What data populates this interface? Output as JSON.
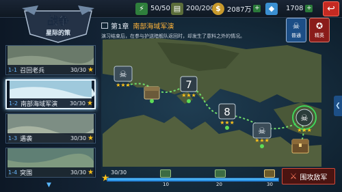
{
  "top_bar": {
    "energy": "50/50",
    "supply": "200/200",
    "gold": "2087万",
    "diamond": "1708",
    "back_icon": "back-arrow-icon"
  },
  "logo": {
    "line1": "战争",
    "line2": "星际的策"
  },
  "chapter": {
    "number": "第1章",
    "name": "南部海域军演",
    "description": "演习结束后，在参与护送暗舰队返回时，却发生了意料之外的情况。"
  },
  "difficulty": {
    "normal_label": "普通",
    "elite_label": "精英"
  },
  "stages": [
    {
      "num": "1-1",
      "name": "召回老兵",
      "progress": "30/30"
    },
    {
      "num": "1-2",
      "name": "南部海域军演",
      "progress": "30/30"
    },
    {
      "num": "1-3",
      "name": "遇袭",
      "progress": "30/30"
    },
    {
      "num": "1-4",
      "name": "突围",
      "progress": "30/30"
    }
  ],
  "map_nodes": [
    {
      "type": "skull",
      "stars": 3
    },
    {
      "type": "chest"
    },
    {
      "type": "number",
      "label": "7",
      "stars": 3
    },
    {
      "type": "number",
      "label": "8",
      "stars": 3
    },
    {
      "type": "skull",
      "stars": 3
    },
    {
      "type": "boss",
      "stars": 3
    },
    {
      "type": "chest"
    }
  ],
  "star_progress": {
    "text": "30/30",
    "fraction": 1.0,
    "milestones": [
      "10",
      "20",
      "30"
    ]
  },
  "raid_button": "围攻敌军",
  "colors": {
    "accent_blue": "#1d86e0",
    "star_gold": "#ffc21a",
    "chapter_orange": "#ffb43a",
    "raid_red": "#d44b3b"
  }
}
